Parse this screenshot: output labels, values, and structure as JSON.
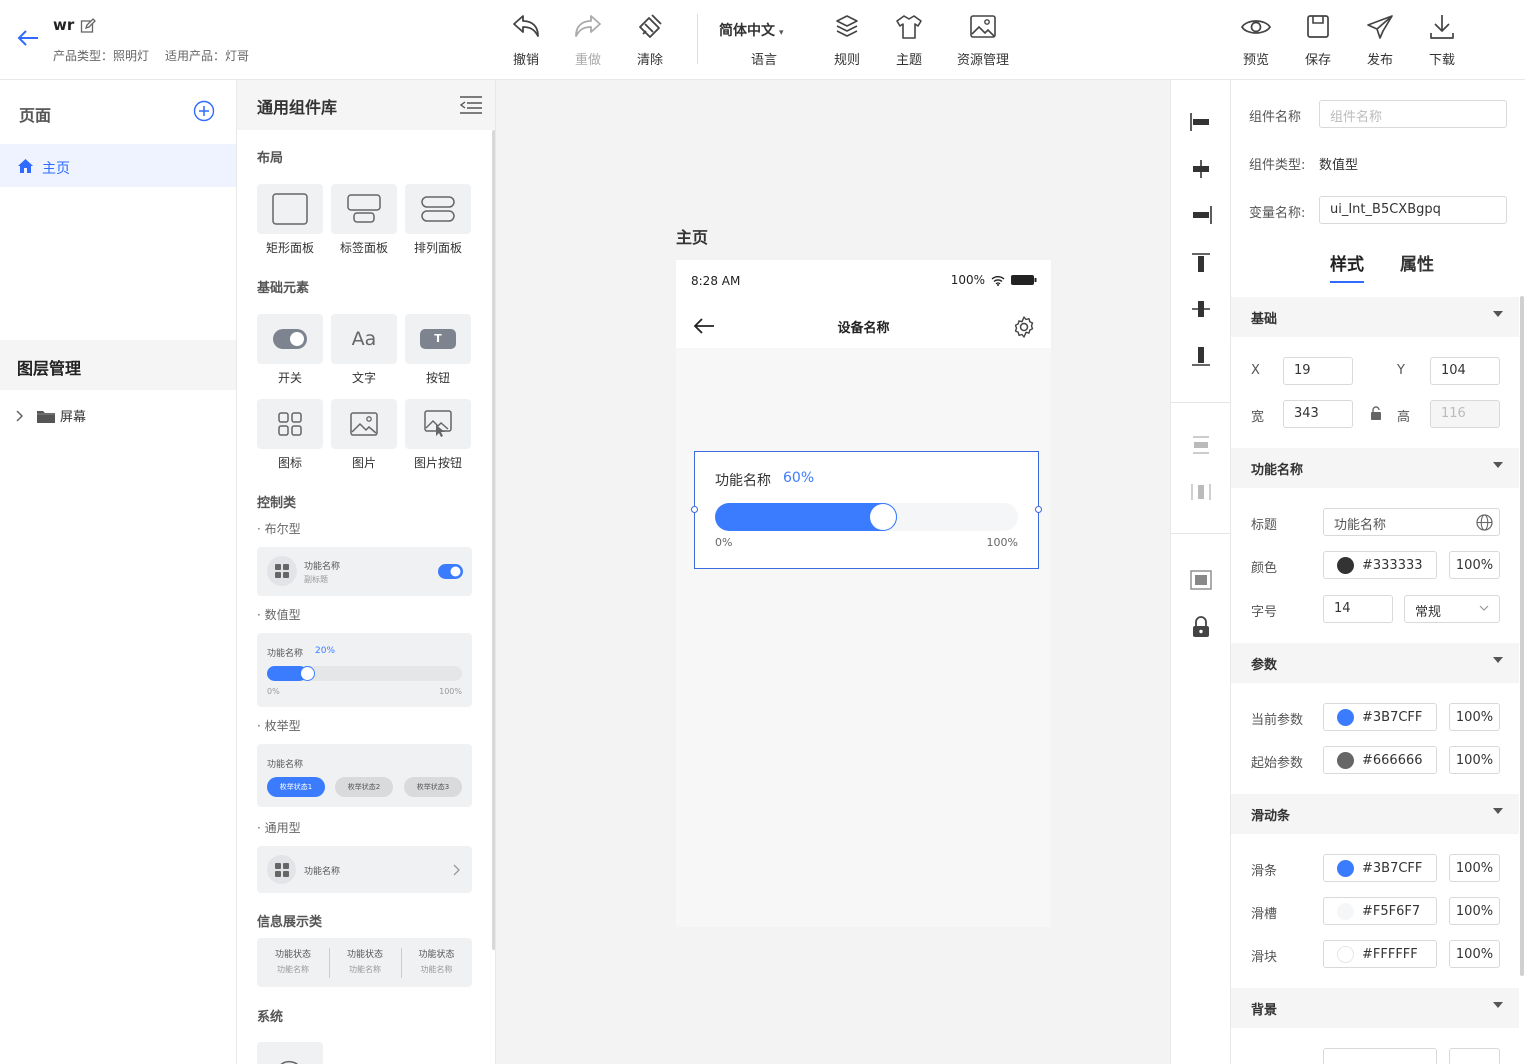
{
  "header": {
    "project_title": "wr",
    "product_type": "产品类型：照明灯",
    "applicable_product": "适用产品：灯哥",
    "toolbar": {
      "undo": "撤销",
      "redo": "重做",
      "clear": "清除",
      "language_value": "简体中文",
      "language": "语言",
      "rules": "规则",
      "theme": "主题",
      "assets": "资源管理",
      "preview": "预览",
      "save": "保存",
      "publish": "发布",
      "download": "下载"
    }
  },
  "pages": {
    "title": "页面",
    "items": [
      {
        "label": "主页"
      }
    ]
  },
  "layers": {
    "title": "图层管理",
    "items": [
      {
        "label": "屏幕"
      }
    ]
  },
  "library": {
    "title": "通用组件库",
    "layout_section": "布局",
    "layout_items": [
      "矩形面板",
      "标签面板",
      "排列面板"
    ],
    "basic_section": "基础元素",
    "basic_items": [
      "开关",
      "文字",
      "按钮",
      "图标",
      "图片",
      "图片按钮"
    ],
    "text_icon": "Aa",
    "button_icon": "T",
    "control_section": "控制类",
    "bool_sub": "· 布尔型",
    "bool_card": {
      "title": "功能名称",
      "subtitle": "副标题"
    },
    "numeric_sub": "· 数值型",
    "numeric_card": {
      "title": "功能名称",
      "value": "20%",
      "min": "0%",
      "max": "100%"
    },
    "enum_sub": "· 枚举型",
    "enum_card": {
      "title": "功能名称",
      "options": [
        "枚举状态1",
        "枚举状态2",
        "枚举状态3"
      ]
    },
    "generic_sub": "· 通用型",
    "generic_card": {
      "title": "功能名称"
    },
    "info_section": "信息展示类",
    "info_card": [
      {
        "state": "功能状态",
        "name": "功能名称"
      },
      {
        "state": "功能状态",
        "name": "功能名称"
      },
      {
        "state": "功能状态",
        "name": "功能名称"
      }
    ],
    "system_section": "系统"
  },
  "canvas": {
    "page_title": "主页",
    "phone": {
      "time": "8:28 AM",
      "battery": "100%",
      "nav_title": "设备名称",
      "slider": {
        "title": "功能名称",
        "value_text": "60%",
        "value": 60,
        "min_label": "0%",
        "max_label": "100%"
      }
    }
  },
  "props": {
    "component_name_label": "组件名称",
    "component_name_placeholder": "组件名称",
    "component_type_label": "组件类型:",
    "component_type_value": "数值型",
    "variable_label": "变量名称:",
    "variable_value": "ui_Int_B5CXBgpq",
    "tabs": [
      "样式",
      "属性"
    ],
    "basic_group": "基础",
    "x_label": "X",
    "x_value": "19",
    "y_label": "Y",
    "y_value": "104",
    "w_label": "宽",
    "w_value": "343",
    "h_label": "高",
    "h_value": "116",
    "func_group": "功能名称",
    "title_label": "标题",
    "title_value": "功能名称",
    "color_label": "颜色",
    "color_value": "#333333",
    "color_alpha": "100%",
    "size_label": "字号",
    "size_value": "14",
    "weight_value": "常规",
    "param_group": "参数",
    "current_label": "当前参数",
    "current_color": "#3B7CFF",
    "current_alpha": "100%",
    "start_label": "起始参数",
    "start_color": "#666666",
    "start_alpha": "100%",
    "slider_group": "滑动条",
    "bar_label": "滑条",
    "bar_color": "#3B7CFF",
    "bar_alpha": "100%",
    "groove_label": "滑槽",
    "groove_color": "#F5F6F7",
    "groove_alpha": "100%",
    "knob_label": "滑块",
    "knob_color": "#FFFFFF",
    "knob_alpha": "100%",
    "bg_group": "背景"
  },
  "colors": {
    "accent": "#3B7CFF",
    "selection": "#3B6BDE",
    "canvas_bg": "#F3F3F3",
    "sidebar_active": "#EEF3FF"
  },
  "icons": [
    "back-arrow-icon",
    "edit-icon",
    "undo-icon",
    "redo-icon",
    "clear-icon",
    "layers-icon",
    "shirt-icon",
    "image-icon",
    "eye-icon",
    "save-icon",
    "send-icon",
    "download-icon",
    "plus-circle-icon",
    "home-icon",
    "chevron-right-icon",
    "folder-icon",
    "collapse-icon",
    "wifi-icon",
    "battery-icon",
    "gear-icon",
    "lock-icon",
    "globe-icon"
  ]
}
